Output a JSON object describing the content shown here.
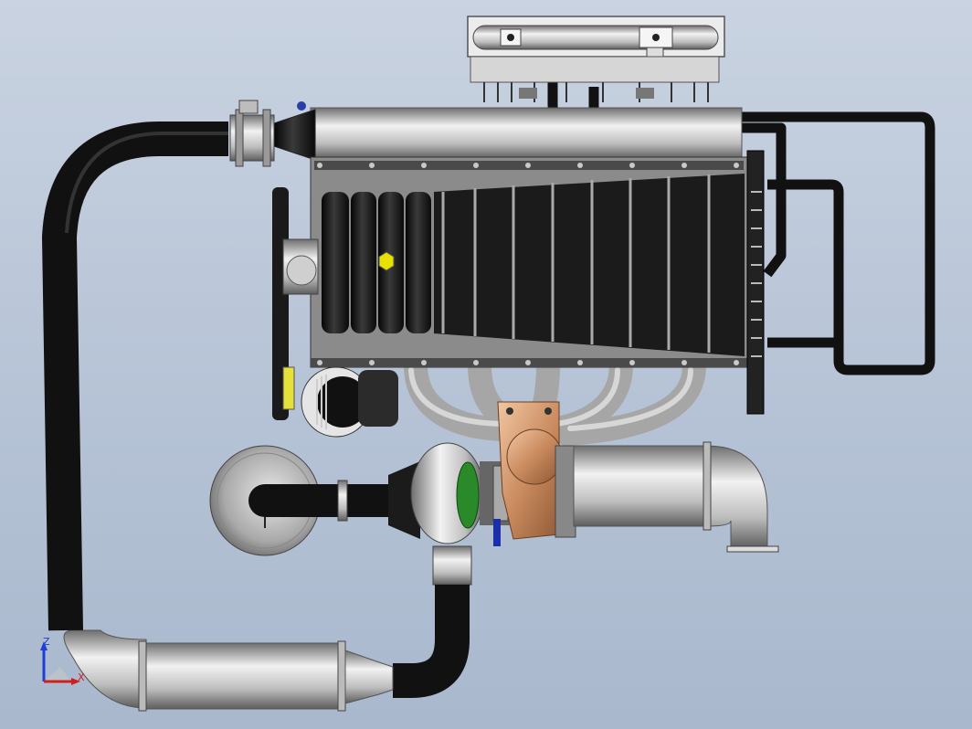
{
  "viewport": {
    "background_top": "#c9d3e1",
    "background_bottom": "#a9b8cd"
  },
  "triad": {
    "z_label": "Z",
    "x_label": "X",
    "z_color": "#1f3fd6",
    "x_color": "#d0201c"
  },
  "model": {
    "description_icons": [
      "intake-pipe",
      "throttle-body",
      "intake-plenum",
      "valve-cover",
      "fan-belt-drive",
      "alternator",
      "exhaust-manifold",
      "turbocharger",
      "air-filter",
      "intercooler",
      "downpipe",
      "oil-cooler"
    ]
  }
}
